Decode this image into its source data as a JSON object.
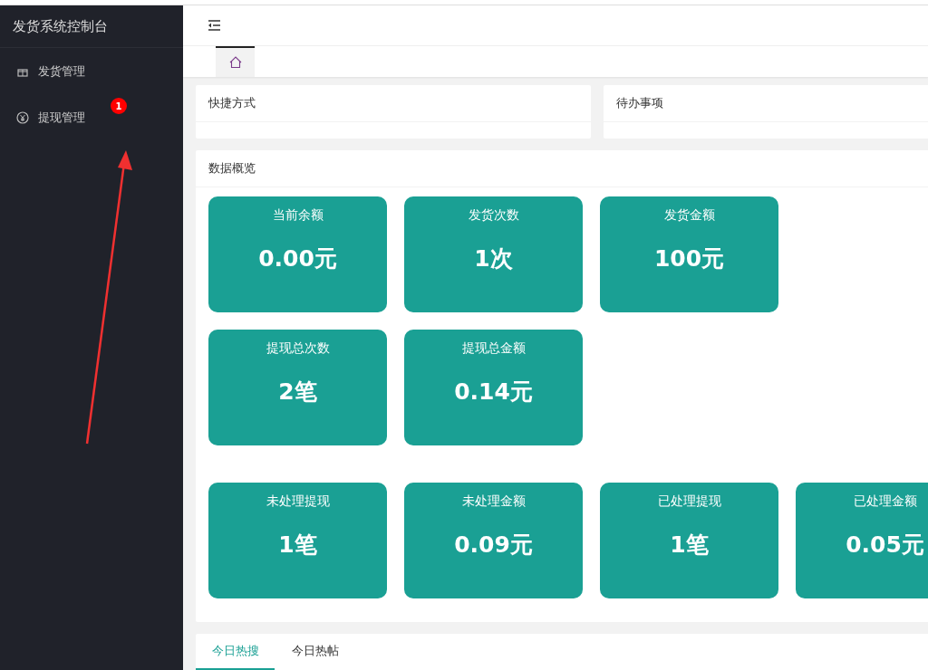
{
  "sidebar": {
    "title": "发货系统控制台",
    "items": [
      {
        "label": "发货管理",
        "kind": "gift"
      },
      {
        "label": "提现管理",
        "kind": "yen",
        "badge": "1"
      }
    ]
  },
  "page_tabs": [
    {
      "kind": "home",
      "selected": true
    }
  ],
  "panels": [
    {
      "title": "快捷方式"
    },
    {
      "title": "待办事项"
    }
  ],
  "overview": {
    "title": "数据概览",
    "groups": [
      [
        {
          "label": "当前余额",
          "value": "0.00元"
        },
        {
          "label": "发货次数",
          "value": "1次"
        },
        {
          "label": "发货金额",
          "value": "100元"
        }
      ],
      [
        {
          "label": "提现总次数",
          "value": "2笔"
        },
        {
          "label": "提现总金额",
          "value": "0.14元"
        }
      ],
      [
        {
          "label": "未处理提现",
          "value": "1笔"
        },
        {
          "label": "未处理金额",
          "value": "0.09元"
        },
        {
          "label": "已处理提现",
          "value": "1笔"
        },
        {
          "label": "已处理金额",
          "value": "0.05元"
        }
      ]
    ]
  },
  "hot_tabs": [
    {
      "label": "今日热搜",
      "selected": true
    },
    {
      "label": "今日热帖",
      "selected": false
    }
  ]
}
